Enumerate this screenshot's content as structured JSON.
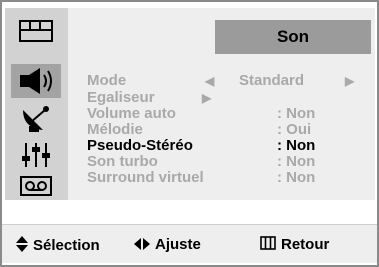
{
  "menu_title": "Son",
  "sidebar": {
    "icons": [
      "picture-icon",
      "speaker-icon",
      "satellite-icon",
      "equalizer-icon",
      "tape-icon"
    ],
    "active_index": 1
  },
  "rows": [
    {
      "label": "Mode",
      "value": "Standard"
    },
    {
      "label": "Egaliseur",
      "value": ""
    },
    {
      "label": "Volume auto",
      "value": ": Non"
    },
    {
      "label": "Mélodie",
      "value": ": Oui"
    },
    {
      "label": "Pseudo-Stéréo",
      "value": ": Non"
    },
    {
      "label": "Son turbo",
      "value": ": Non"
    },
    {
      "label": "Surround virtuel",
      "value": ": Non"
    }
  ],
  "selected_row": "Pseudo-Stéréo",
  "footer": {
    "select_label": "Sélection",
    "adjust_label": "Ajuste",
    "return_label": "Retour"
  },
  "colors": {
    "panel_bg": "#eeeeee",
    "sidebar_bg": "#d2d2d2",
    "active_icon_bg": "#a3a3a3",
    "title_bg": "#9b9b9b",
    "inactive_text": "#a9a9a9",
    "selected_text": "#000000"
  }
}
